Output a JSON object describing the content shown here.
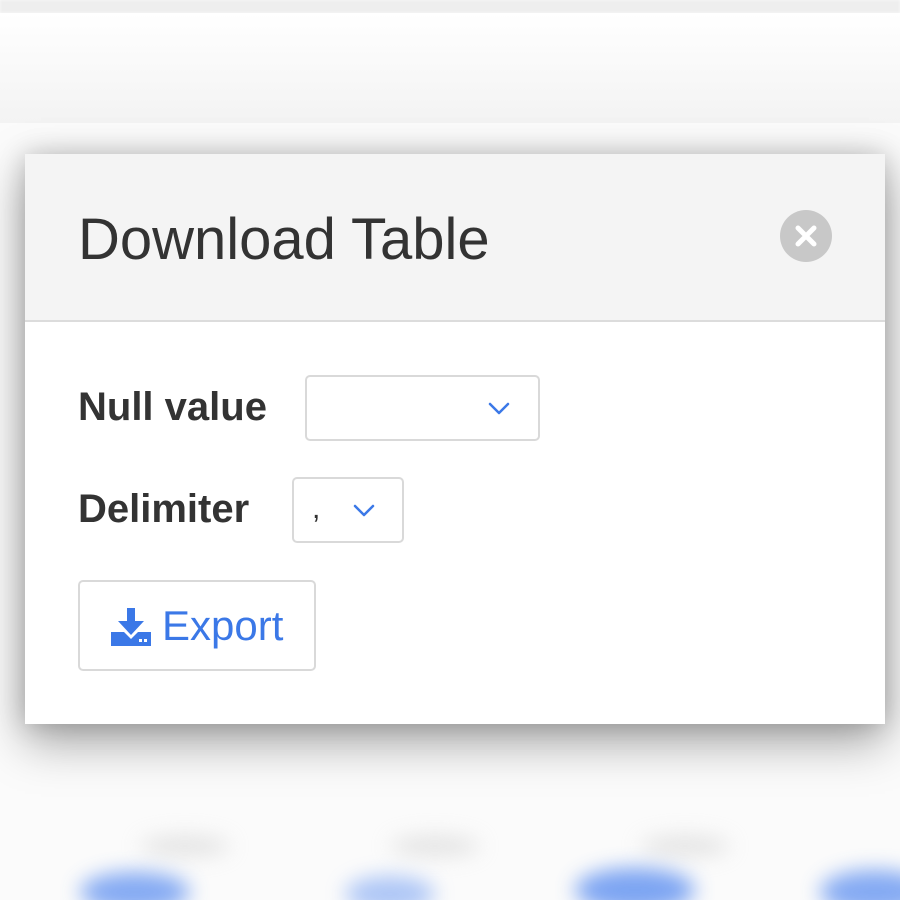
{
  "dialog": {
    "title": "Download Table",
    "close_icon": "close-icon"
  },
  "form": {
    "null_value": {
      "label": "Null value",
      "selected": ""
    },
    "delimiter": {
      "label": "Delimiter",
      "selected": ","
    }
  },
  "actions": {
    "export_label": "Export",
    "export_icon": "download-icon"
  },
  "colors": {
    "accent": "#3b78e7",
    "header_bg": "#f4f4f4",
    "close_bg": "#c8c8c8",
    "text": "#333333"
  }
}
